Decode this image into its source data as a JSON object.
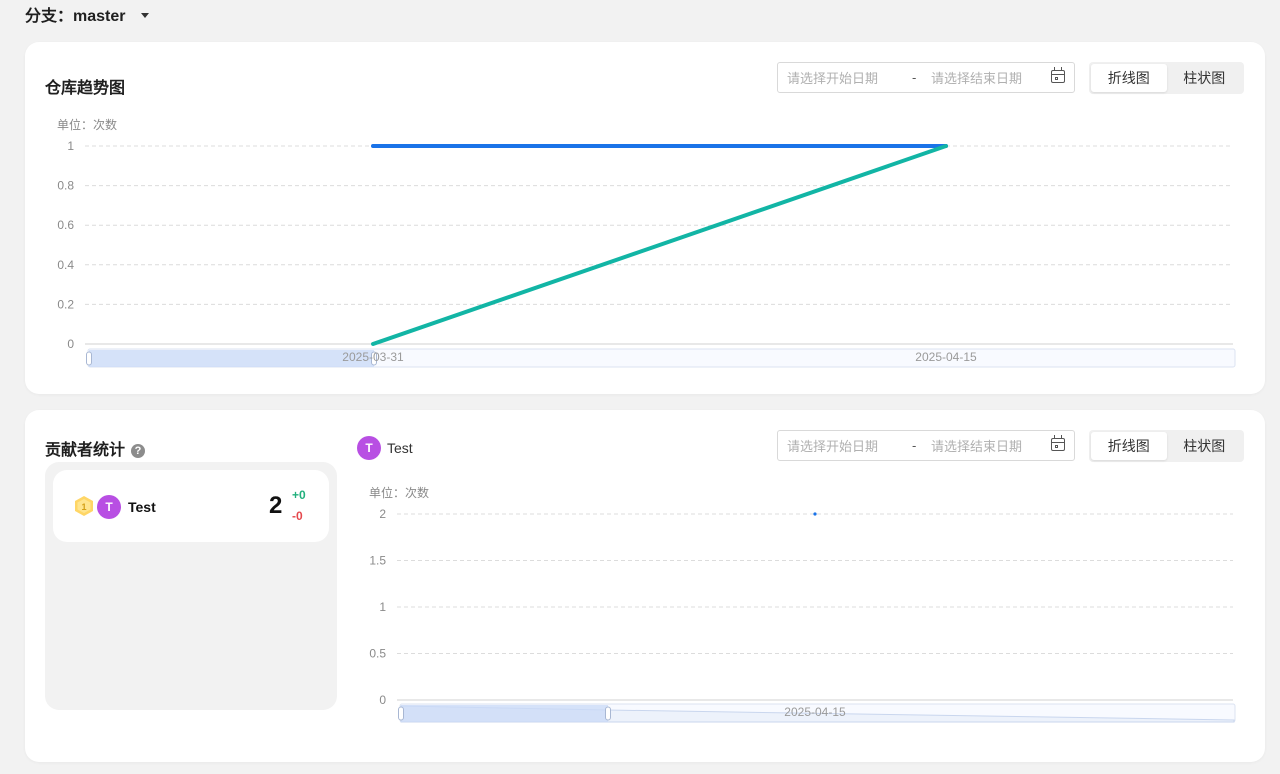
{
  "branch": {
    "label": "分支：master"
  },
  "repo_trend": {
    "title": "仓库趋势图",
    "date_range": {
      "start_placeholder": "请选择开始日期",
      "separator": "-",
      "end_placeholder": "请选择结束日期"
    },
    "chart_types": [
      "折线图",
      "柱状图"
    ],
    "active_chart_type": "折线图",
    "unit": "单位：次数"
  },
  "contributors": {
    "title": "贡献者统计",
    "list": [
      {
        "rank": "1",
        "avatar_letter": "T",
        "name": "Test",
        "count": "2",
        "additions": "+0",
        "deletions": "-0"
      }
    ],
    "legend": {
      "avatar_letter": "T",
      "name": "Test"
    },
    "date_range": {
      "start_placeholder": "请选择开始日期",
      "separator": "-",
      "end_placeholder": "请选择结束日期"
    },
    "chart_types": [
      "折线图",
      "柱状图"
    ],
    "active_chart_type": "折线图",
    "unit": "单位：次数"
  },
  "chart_data": [
    {
      "type": "line",
      "x": [
        "2025-03-31",
        "2025-04-15"
      ],
      "series": [
        {
          "values": [
            1,
            1
          ],
          "color": "#1a73e8"
        },
        {
          "values": [
            0,
            1
          ],
          "color": "#12b5a5"
        }
      ],
      "yticks": [
        0,
        0.2,
        0.4,
        0.6,
        0.8,
        1
      ],
      "ylim": [
        0,
        1
      ],
      "grid": true,
      "ylabel": "单位：次数"
    },
    {
      "type": "line",
      "x": [
        "2025-04-15"
      ],
      "series": [
        {
          "name": "Test",
          "values": [
            2
          ],
          "color": "#1a73e8"
        }
      ],
      "yticks": [
        0,
        0.5,
        1,
        1.5,
        2
      ],
      "ylim": [
        0,
        2
      ],
      "grid": true,
      "ylabel": "单位：次数"
    }
  ]
}
